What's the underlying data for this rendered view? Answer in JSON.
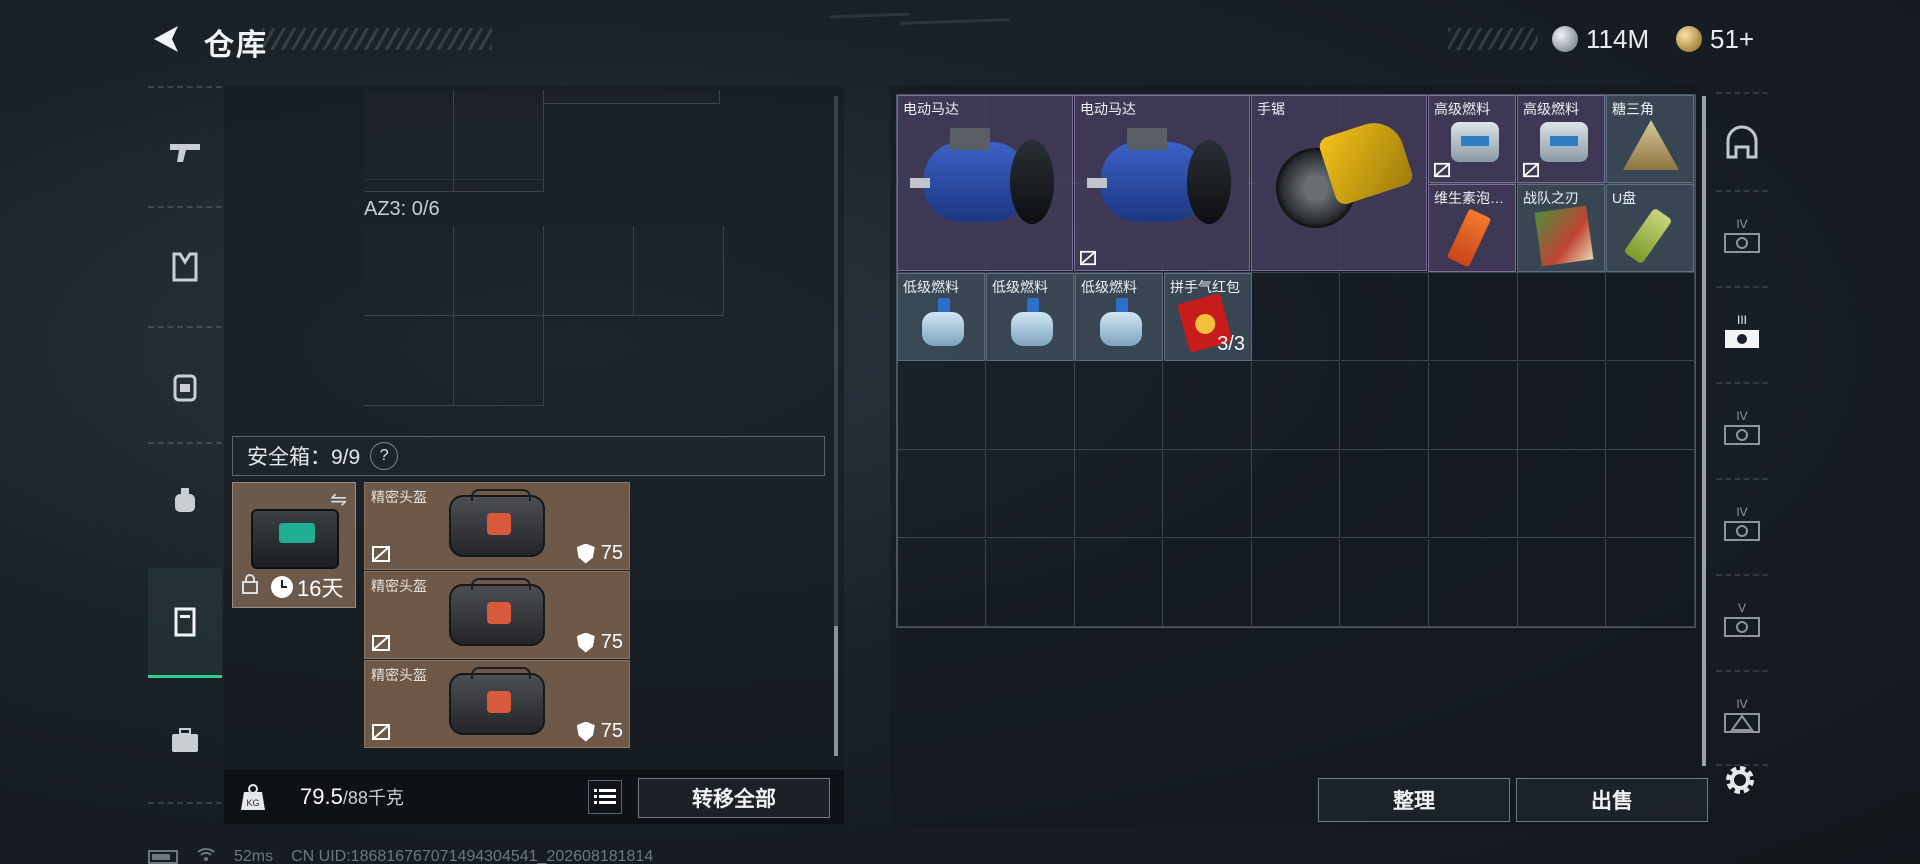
{
  "header": {
    "title": "仓库",
    "currencies": [
      {
        "icon": "silver-coin-icon",
        "value": "114M"
      },
      {
        "icon": "gold-coin-icon",
        "value": "51+"
      }
    ]
  },
  "left_rail": {
    "items": [
      {
        "icon": "gun-icon"
      },
      {
        "icon": "vest-icon"
      },
      {
        "icon": "backpack-icon"
      },
      {
        "icon": "pouch-icon"
      },
      {
        "icon": "safebox-icon",
        "active": true
      },
      {
        "icon": "toolbox-icon"
      }
    ]
  },
  "container": {
    "label": "AZ3: 0/6"
  },
  "safebox": {
    "label": "安全箱：9/9",
    "help": "?",
    "duration": "16天",
    "items": [
      {
        "name": "精密头盔",
        "armor": "75"
      },
      {
        "name": "精密头盔",
        "armor": "75"
      },
      {
        "name": "精密头盔",
        "armor": "75"
      }
    ]
  },
  "weight": {
    "current": "79.5",
    "max": "/88千克",
    "unit_icon": "KG"
  },
  "buttons": {
    "transfer_all": "转移全部",
    "sort": "整理",
    "sell": "出售"
  },
  "warehouse": {
    "items": [
      {
        "name": "电动马达",
        "kind": "motor"
      },
      {
        "name": "电动马达",
        "kind": "motor"
      },
      {
        "name": "手锯",
        "kind": "saw"
      },
      {
        "name": "高级燃料",
        "kind": "can"
      },
      {
        "name": "高级燃料",
        "kind": "can"
      },
      {
        "name": "糖三角",
        "kind": "triangle"
      },
      {
        "name": "维生素泡…",
        "kind": "vitamin"
      },
      {
        "name": "战队之刃",
        "kind": "book"
      },
      {
        "name": "U盘",
        "kind": "usb"
      },
      {
        "name": "低级燃料",
        "kind": "lowfuel"
      },
      {
        "name": "低级燃料",
        "kind": "lowfuel"
      },
      {
        "name": "低级燃料",
        "kind": "lowfuel"
      },
      {
        "name": "拼手气红包",
        "kind": "redpack",
        "count": "3/3"
      }
    ]
  },
  "right_rail": {
    "items": [
      {
        "icon": "helmet-slot-icon",
        "level": ""
      },
      {
        "icon": "vehicle-iv-icon",
        "level": "IV"
      },
      {
        "icon": "vehicle-iii-icon",
        "level": "III"
      },
      {
        "icon": "vehicle-iv-icon",
        "level": "IV"
      },
      {
        "icon": "vehicle-iv-icon",
        "level": "IV"
      },
      {
        "icon": "vehicle-v-icon",
        "level": "V"
      },
      {
        "icon": "vehicle-iv-icon",
        "level": "IV"
      }
    ]
  },
  "status_bar": {
    "ping": "52ms",
    "uid": "CN UID:18681676707149430454​1_202608181814"
  }
}
